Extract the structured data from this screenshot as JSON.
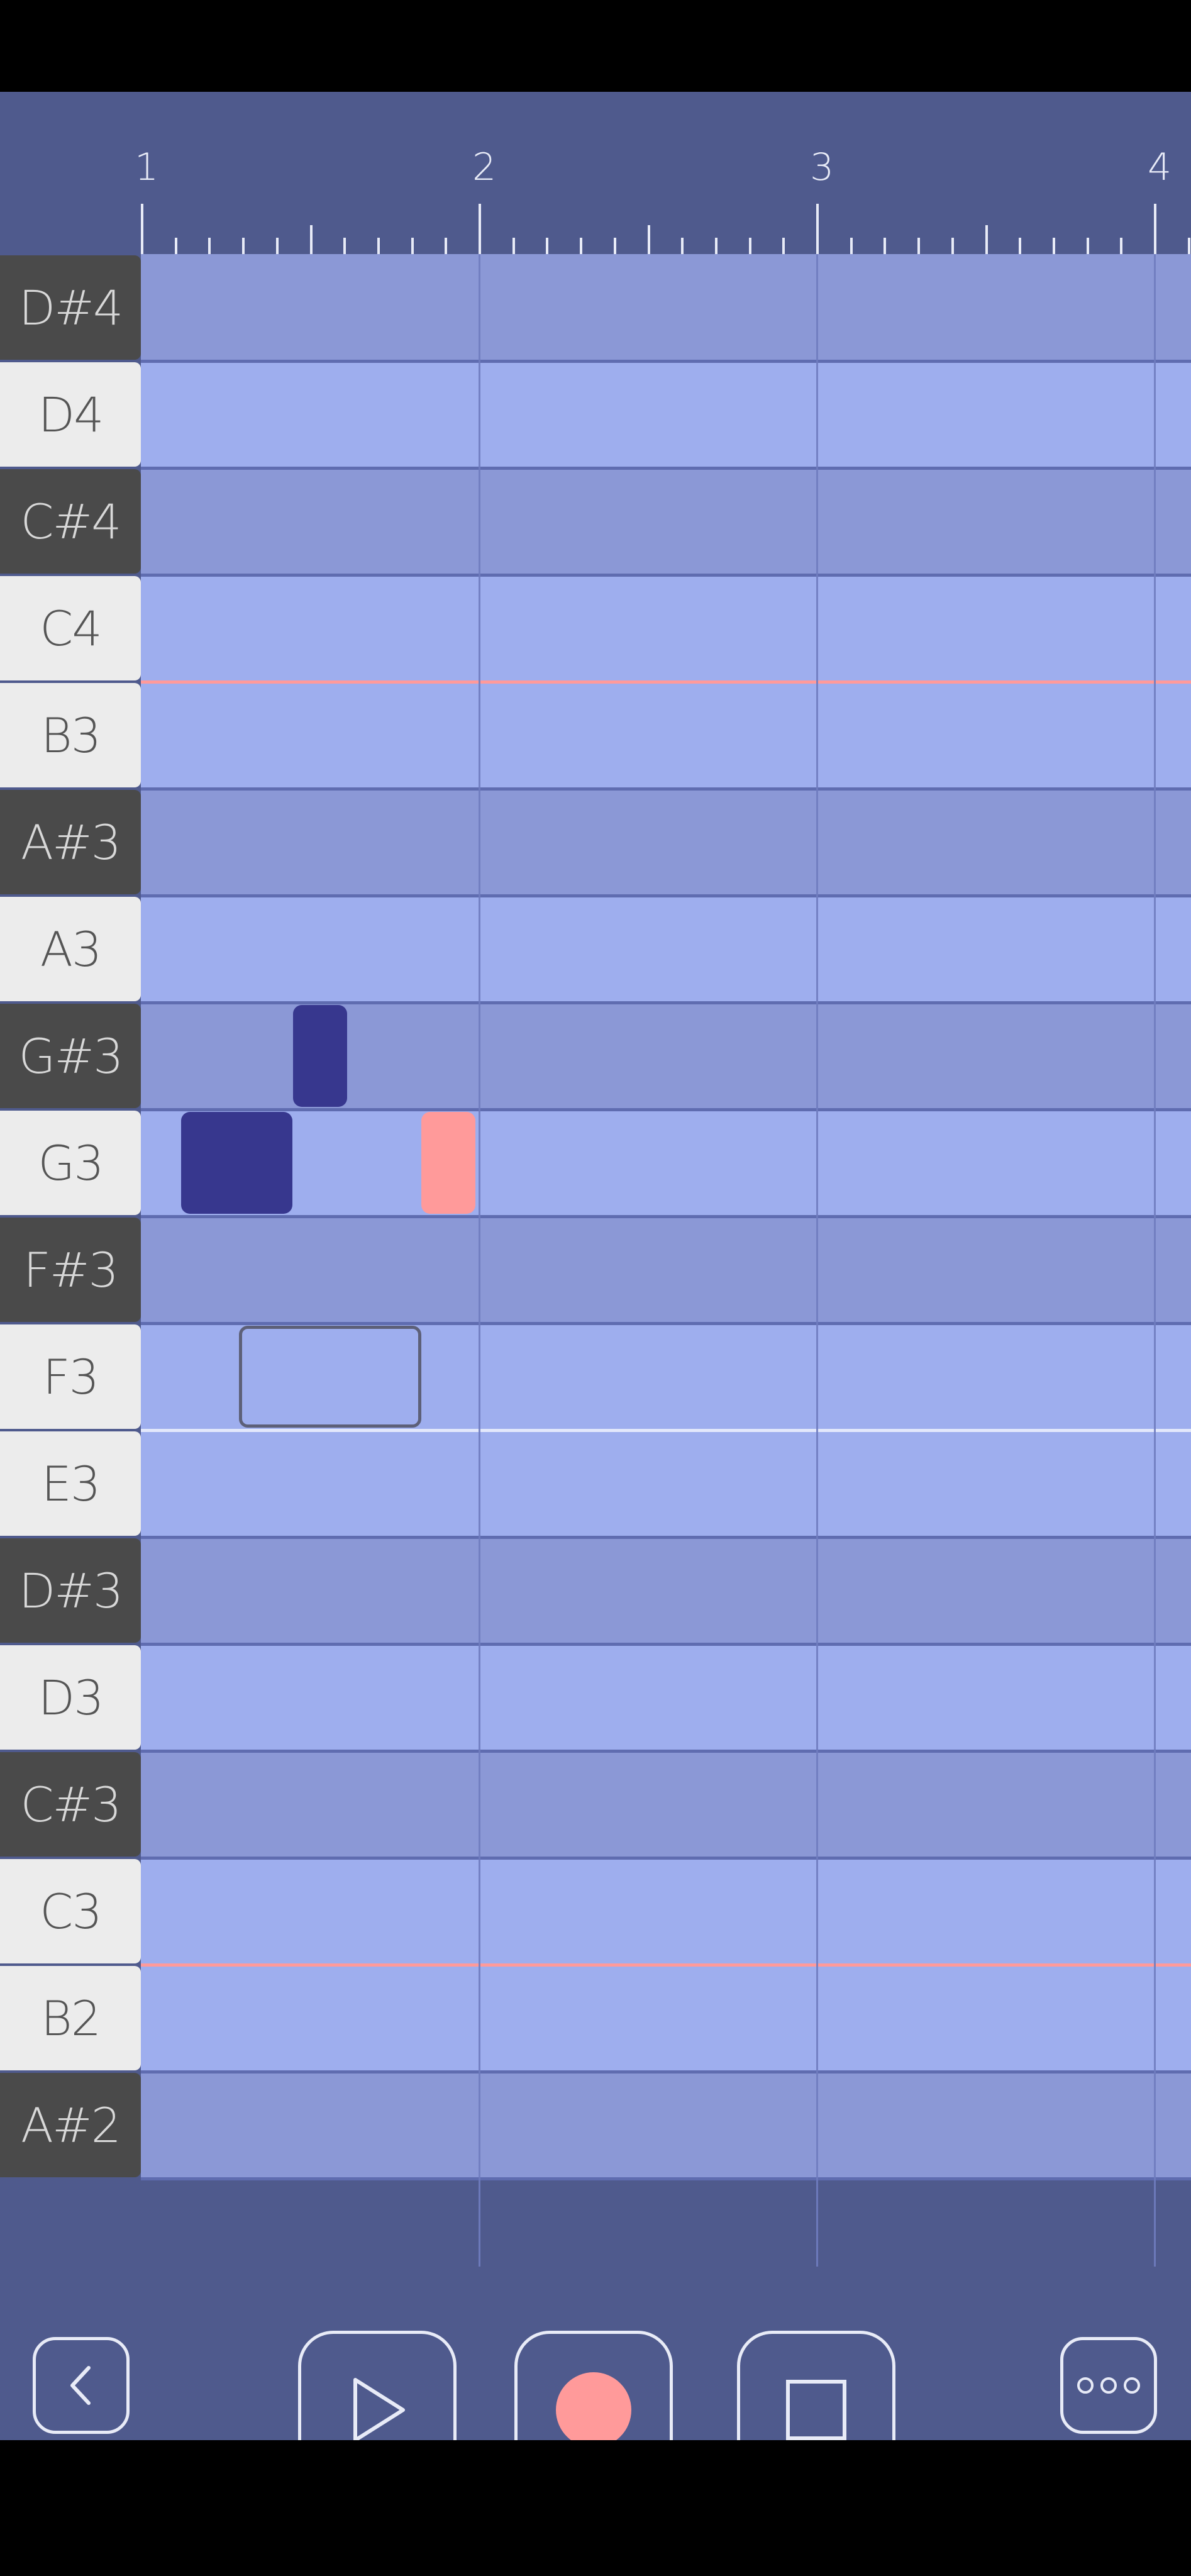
{
  "ruler": {
    "bar_numbers": [
      "1",
      "2",
      "3",
      "4"
    ]
  },
  "piano_roll": {
    "keys": [
      {
        "label": "D#4",
        "type": "black"
      },
      {
        "label": "D4",
        "type": "white"
      },
      {
        "label": "C#4",
        "type": "black"
      },
      {
        "label": "C4",
        "type": "white"
      },
      {
        "label": "B3",
        "type": "white"
      },
      {
        "label": "A#3",
        "type": "black"
      },
      {
        "label": "A3",
        "type": "white"
      },
      {
        "label": "G#3",
        "type": "black"
      },
      {
        "label": "G3",
        "type": "white"
      },
      {
        "label": "F#3",
        "type": "black"
      },
      {
        "label": "F3",
        "type": "white"
      },
      {
        "label": "E3",
        "type": "white"
      },
      {
        "label": "D#3",
        "type": "black"
      },
      {
        "label": "D3",
        "type": "white"
      },
      {
        "label": "C#3",
        "type": "black"
      },
      {
        "label": "C3",
        "type": "white"
      },
      {
        "label": "B2",
        "type": "white"
      },
      {
        "label": "A#2",
        "type": "black"
      }
    ],
    "notes": [
      {
        "pitch": "G#3",
        "start_beat": 1.45,
        "length_beats": 0.16,
        "style": "dark"
      },
      {
        "pitch": "G3",
        "start_beat": 1.12,
        "length_beats": 0.33,
        "style": "dark"
      },
      {
        "pitch": "G3",
        "start_beat": 1.83,
        "length_beats": 0.16,
        "style": "pink"
      },
      {
        "pitch": "F3",
        "start_beat": 1.29,
        "length_beats": 0.54,
        "style": "ghost"
      }
    ]
  },
  "controls": {
    "back_icon": "chevron-left-icon",
    "play_icon": "play-icon",
    "record_icon": "record-icon",
    "stop_icon": "stop-icon",
    "more_icon": "more-dots-icon"
  },
  "colors": {
    "accent_pink": "#ff9a9a",
    "note_dark": "#37378e",
    "background": "#4f5a8d"
  }
}
